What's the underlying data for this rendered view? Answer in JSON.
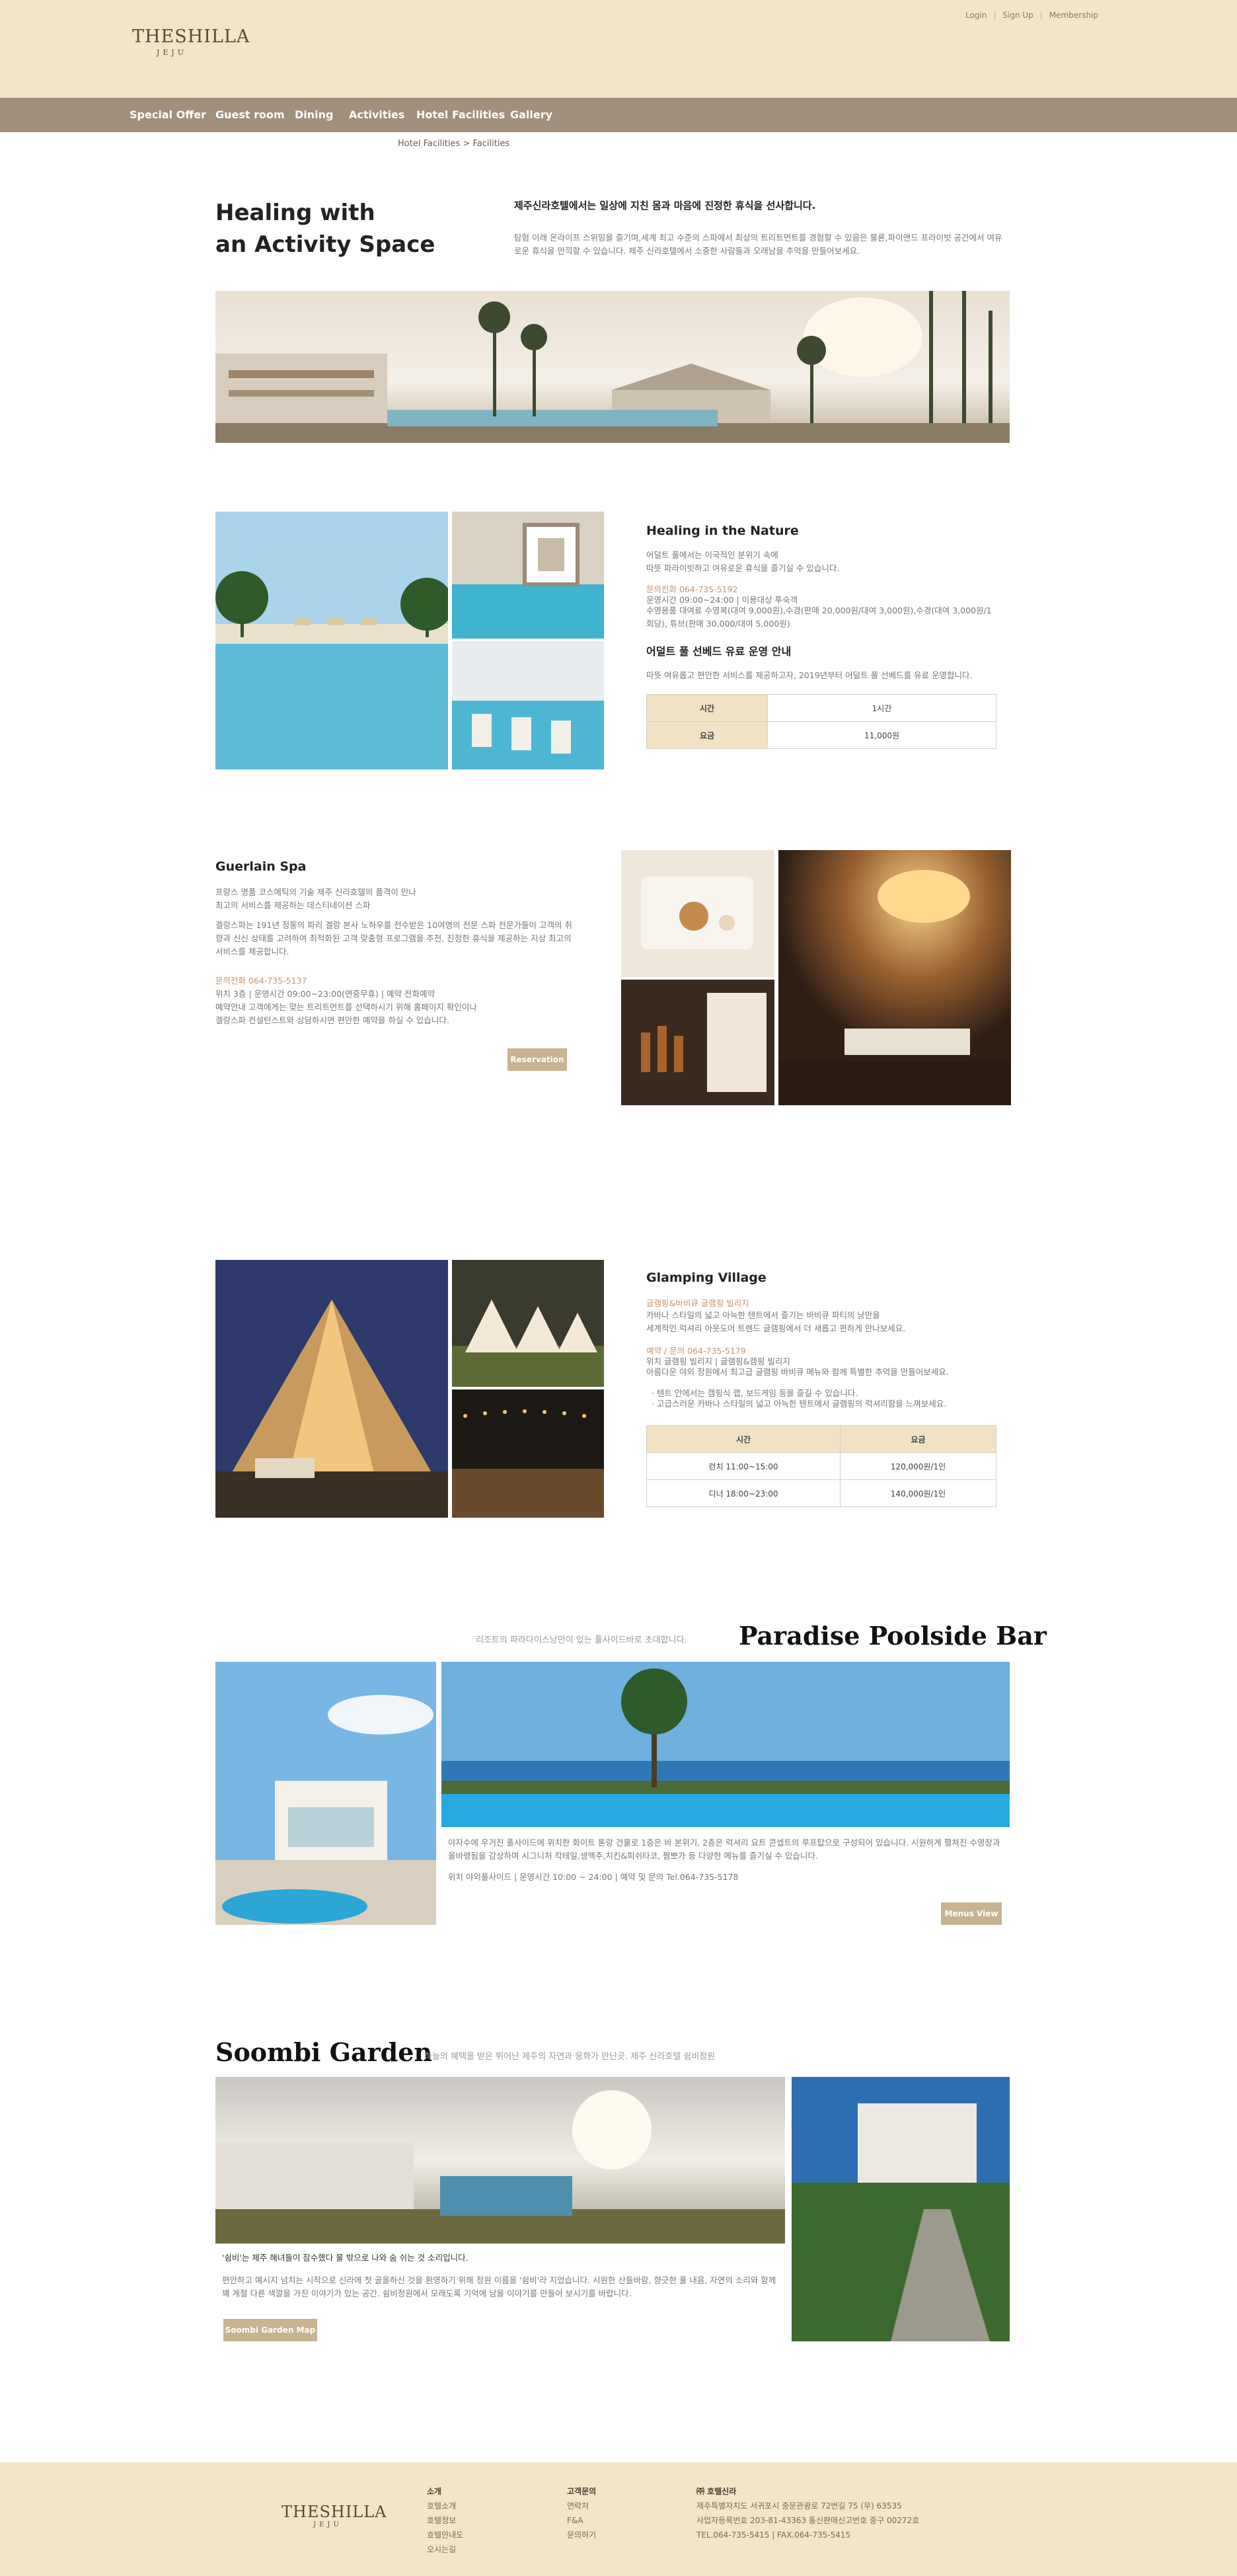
{
  "header": {
    "logo_main": "THESHILLA",
    "logo_sub": "JEJU",
    "links": [
      "Login",
      "Sign Up",
      "Membership"
    ]
  },
  "nav": {
    "items": [
      "Special Offer",
      "Guest room",
      "Dining",
      "Activities",
      "Hotel Facilities",
      "Gallery"
    ]
  },
  "breadcrumb": {
    "parent": "Hotel Facilities",
    "separator": ">",
    "current": "Facilities"
  },
  "intro": {
    "title_line1": "Healing with",
    "title_line2": "an Activity Space",
    "headline": "제주신라호텔에서는 일상에 지친 몸과 마음에 진정한 휴식을 선사합니다.",
    "body": "탐험 이래 온라이프 스위밍을 즐기며,세계 최고 수준의 스파에서 최상의 트리트먼트를 경험할 수 있음은 물론,파이앤드 프라이빗 공간에서 여유로운 휴식을 만끽할 수 있습니다. 제주 신라호텔에서 소중한 사람들과 오래남을 추억을 만들어보세요."
  },
  "pool": {
    "title": "Healing in the Nature",
    "desc": "어덜트 풀에서는 이국적인 분위기 속에\n따뜻 파라이빗하고 여유로운 휴식을 즐기실 수 있습니다.",
    "contact": "문의전화 064-735-5192",
    "hours": "운영시간 09:00~24:00 | 이용대상 투숙객",
    "fee": "수영용품 대여료 수영복(대여 9,000원),수경(판매 20,000원/대여 3,000원),수경(대여 3,000원/1회당), 튜브(판매 30,000/대여 5,000원)",
    "sub_title": "어덜트 풀 선베드 유료 운영 안내",
    "sub_desc": "따뜻 여유롭고 편안한 서비스를 제공하고자, 2019년부터 어덜트 풀 선베드를 유료 운영합니다.",
    "table": [
      [
        "시간",
        "1시간"
      ],
      [
        "요금",
        "11,000원"
      ]
    ]
  },
  "spa": {
    "title": "Guerlain Spa",
    "desc1": "프랑스 명품 코스메틱의 기술 제주 신라호텔의 품격이 만나\n최고의 서비스를 제공하는 데스티네이션 스파",
    "desc2": "겔랑스파는 191년 정통의 파리 겔랑 본사 노하우를 전수받은 10여명의 전문 스파 전문가들이 고객의 취향과 신신 상태를 고려하여 최적화된 고객 맞춤형 프로그램을 추천, 진정한 휴식을 제공하는 지상 최고의 서비스를 제공합니다.",
    "contact": "문의전화 064-735-5137",
    "hours": "위치 3층 | 운영시간 09:00~23:00(연중무휴) | 예약 전화예약",
    "note": "예약안내 고객에게는 맞는 트리트먼트를 선택하시기 위해 홈페이지 확인이나\n겔랑스파 컨설턴스트와 상담하시면 편안한 예약을 하실 수 있습니다.",
    "button": "Reservation"
  },
  "glamping": {
    "title": "Glamping Village",
    "name": "글램핑&바비큐 글램핑 빌리지",
    "desc": "카바나 스타일의 넓고 아늑한 텐트에서 즐기는 바비큐 파티의 낭만을\n세계적인 럭셔리 아웃도어 트렌드 글램핑에서 더 새롭고 편하게 만나보세요.",
    "contact": "예약 / 문의 064-735-5179",
    "location": "위치 글램핑 빌리지 | 글램핑&캠핑 빌리지",
    "location2": "아름다운 야외 정원에서 최고급 글램핑 바비큐 메뉴와 함께 특별한 추억을 만들어보세요.",
    "bullet1": "· 텐트 안에서는 캠핑식 랩, 보드게임 등을 즐길 수 있습니다.",
    "bullet2": "· 고급스러운 카바나 스타일의 넓고 아늑한 텐트에서 글램핑의 럭셔리함을 느껴보세요.",
    "table_header": [
      "시간",
      "요금"
    ],
    "table": [
      [
        "런치 11:00~15:00",
        "120,000원/1인"
      ],
      [
        "디너 18:00~23:00",
        "140,000원/1인"
      ]
    ]
  },
  "bar": {
    "tagline": "리조트의 파라다이스낭만이 있는 풀사이드바로 초대합니다.",
    "title": "Paradise Poolside Bar",
    "desc": "야자수에 우거진 풀사이드에 위치한 화이트 톤랑 건물로 1층은 바 본위기, 2층은 럭셔리 요트 콘셉트의 루프탑으로 구성되어 있습니다. 시원하게 펼쳐진 수영장과 올바랭됨을 감상하며 시그니처 칵테일,생맥주,치킨&피쉬타코, 짬뽀가 등 다양한 메뉴를 즐기실 수 있습니다.",
    "info": "위치 야외풀사이드 | 운영시간 10:00 ~ 24:00 | 예약 및 문의 Tel.064-735-5178",
    "button": "Menus View"
  },
  "garden": {
    "title": "Soombi Garden",
    "tagline": "하늘의 혜택을 받은 뛰어난 제주의 자연과 웅화가 만난곳. 제주 신라호텔 쉼비정원",
    "quote": "'쉼비'는 제주 해녀들이 잠수했다 물 밖으로 나와 숨 쉬는 것 소리입니다.",
    "desc": "편안하고 예시지 넘치는 시작으로 신라에 첫 골올하신 것을 환영하기 위해 정원 이름을 '쉼비'라 지었습니다. 시원한 산들바람, 향긋한 풀 내음, 자연의 소리와 함께 꽤 계절 다른 색깔을 가진 이야기가 있는 공간. 쉼비정원에서 모래도록 기억에 남을 이야기를 만들어 보시기를 바랍니다.",
    "button": "Soombi Garden Map"
  },
  "footer": {
    "logo_main": "THESHILLA",
    "logo_sub": "JEJU",
    "col1_title": "소개",
    "col1": [
      "호텔소개",
      "호텔정보",
      "호텔안내도",
      "오시는길"
    ],
    "col2_title": "고객문의",
    "col2": [
      "연락처",
      "F&A",
      "문의하기"
    ],
    "col3_title": "㈜ 호텔신라",
    "col3": [
      "제주특별자치도 서귀포시 중문관광로 72번길 75 (우) 63535",
      "사업자등록번호 203-81-43363 통신판매신고번호 중구 00272호",
      "TEL.064-735-5415 | FAX.064-735-5415"
    ]
  },
  "colors": {
    "header_bg": "#f3e5c5",
    "nav_bg": "#a28f7b",
    "button_bg": "#c8b290",
    "highlight_text": "#c9956e"
  }
}
